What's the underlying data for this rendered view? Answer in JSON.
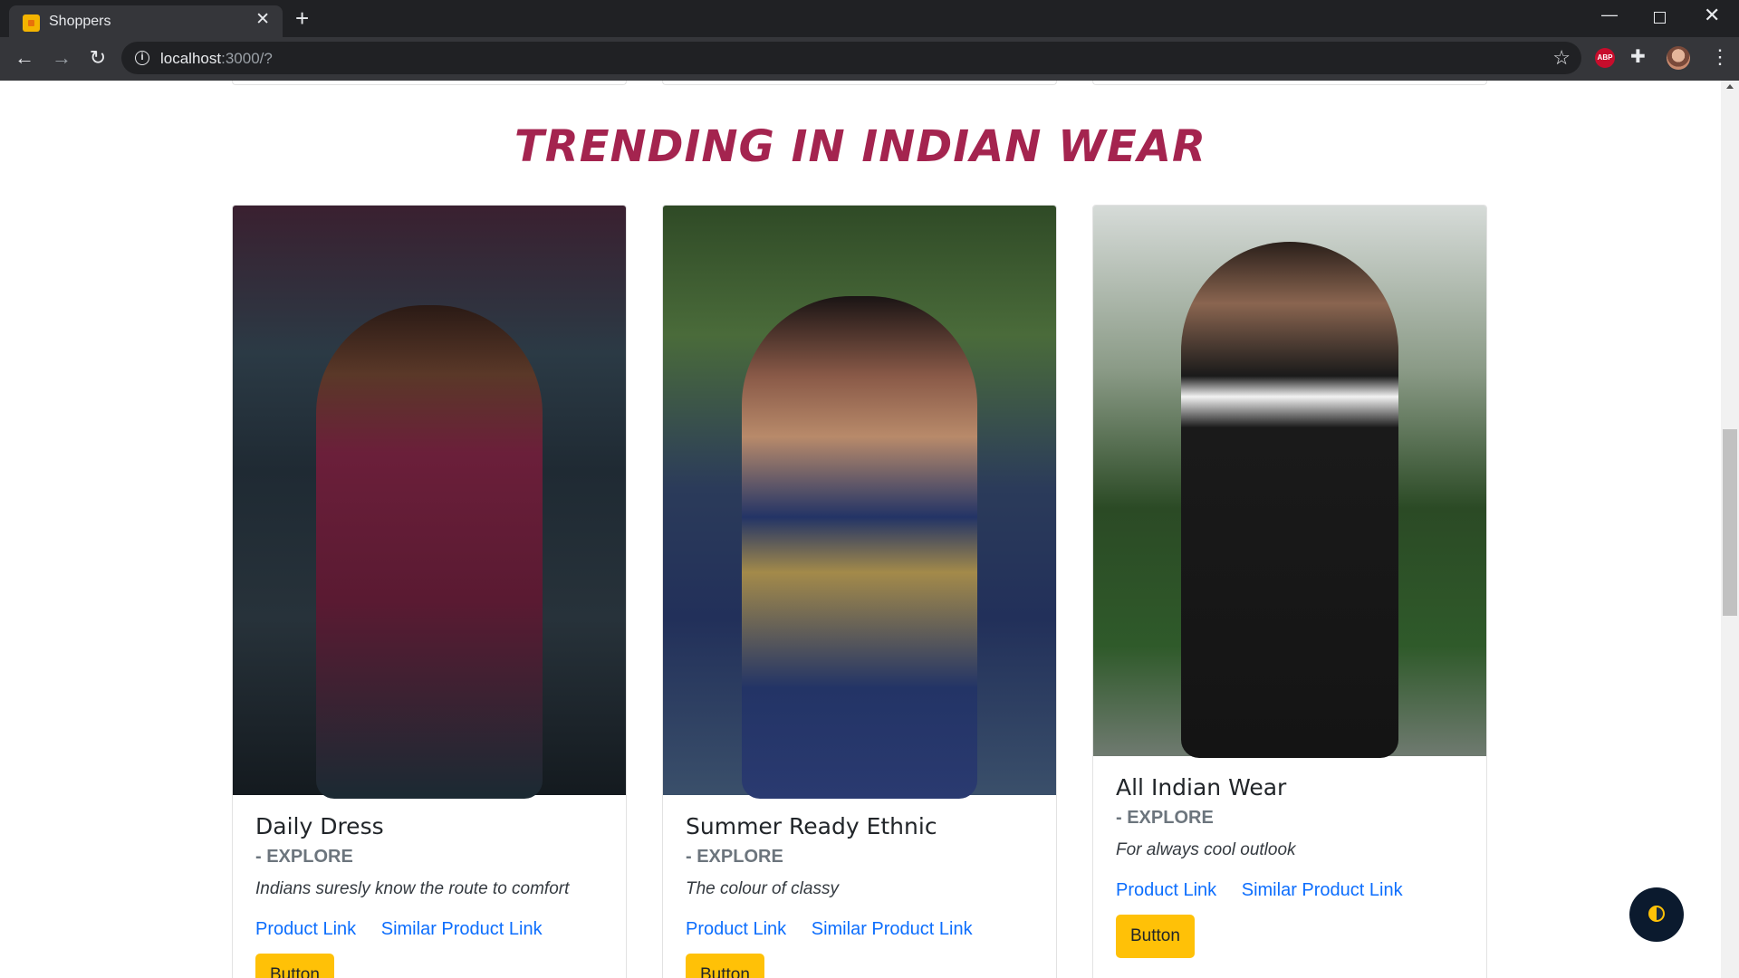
{
  "browser": {
    "tab_title": "Shoppers",
    "url_host": "localhost",
    "url_rest": ":3000/?",
    "extension_abp": "ABP"
  },
  "section": {
    "title": "TRENDING IN INDIAN WEAR"
  },
  "cards": [
    {
      "title": "Daily Dress",
      "subtitle": "- EXPLORE",
      "text": "Indians suresly know the route to comfort",
      "link1": "Product Link",
      "link2": "Similar Product Link",
      "button": "Button"
    },
    {
      "title": "Summer Ready Ethnic",
      "subtitle": "- EXPLORE",
      "text": "The colour of classy",
      "link1": "Product Link",
      "link2": "Similar Product Link",
      "button": "Button"
    },
    {
      "title": "All Indian Wear",
      "subtitle": "- EXPLORE",
      "text": "For always cool outlook",
      "link1": "Product Link",
      "link2": "Similar Product Link",
      "button": "Button"
    }
  ],
  "colors": {
    "title": "#a4244f",
    "link": "#0d6efd",
    "button": "#ffc107",
    "fab": "#0b1a2e"
  },
  "icons": {
    "back": "arrow-left-icon",
    "forward": "arrow-right-icon",
    "reload": "reload-icon",
    "info": "info-icon",
    "bookmark": "star-icon",
    "extensions": "puzzle-icon",
    "menu": "kebab-menu-icon",
    "theme_toggle": "half-moon-icon"
  }
}
